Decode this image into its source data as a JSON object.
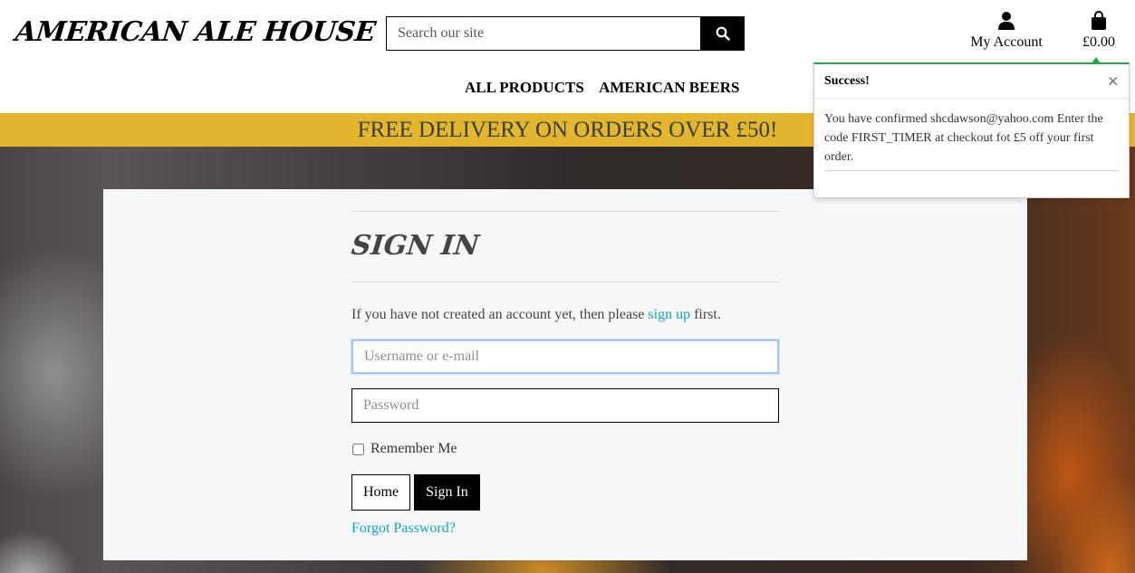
{
  "header": {
    "logo": "AMERICAN ALE HOUSE",
    "search_placeholder": "Search our site",
    "account_label": "My Account",
    "cart_total": "£0.00"
  },
  "nav": {
    "items": [
      "ALL PRODUCTS",
      "AMERICAN BEERS"
    ]
  },
  "banner": {
    "text": "FREE DELIVERY ON ORDERS OVER £50!"
  },
  "signin": {
    "title": "SIGN IN",
    "intro_before": "If you have not created an account yet, then please ",
    "intro_link": "sign up",
    "intro_after": " first.",
    "username_placeholder": "Username or e-mail",
    "password_placeholder": "Password",
    "remember_label": "Remember Me",
    "home_button": "Home",
    "signin_button": "Sign In",
    "forgot_link": "Forgot Password?"
  },
  "toast": {
    "title": "Success!",
    "message": "You have confirmed shcdawson@yahoo.com Enter the code FIRST_TIMER at checkout fot £5 off your first order.",
    "close": "×"
  },
  "colors": {
    "banner": "#e2b62f",
    "link": "#17a2b8",
    "toast_accent": "#2ea44f"
  }
}
